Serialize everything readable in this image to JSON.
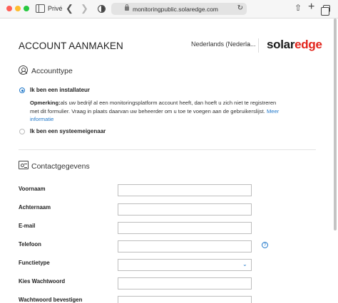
{
  "browser": {
    "private_label": "Privé",
    "url": "monitoringpublic.solaredge.com"
  },
  "header": {
    "title": "ACCOUNT AANMAKEN",
    "language": "Nederlands (Nederla...",
    "logo_main": "solar",
    "logo_accent": "edge"
  },
  "account_type": {
    "title": "Accounttype",
    "options": [
      {
        "label": "Ik ben een installateur",
        "selected": true
      },
      {
        "label": "Ik ben een systeemeigenaar",
        "selected": false
      }
    ],
    "note_bold": "Opmerking:",
    "note_text": "als uw bedrijf al een monitoringsplatform account heeft, dan hoeft u zich niet te registreren met dit formulier. Vraag in plaats daarvan uw beheerder om u toe te voegen aan de gebruikerslijst. ",
    "note_link": "Meer informatie"
  },
  "contact": {
    "title": "Contactgegevens",
    "fields": [
      {
        "label": "Voornaam",
        "value": ""
      },
      {
        "label": "Achternaam",
        "value": ""
      },
      {
        "label": "E-mail",
        "value": ""
      },
      {
        "label": "Telefoon",
        "value": ""
      },
      {
        "label": "Functietype",
        "value": ""
      },
      {
        "label": "Kies Wachtwoord",
        "value": ""
      },
      {
        "label": "Wachtwoord bevestigen",
        "value": ""
      }
    ]
  },
  "colors": {
    "accent": "#1f77c9",
    "brand_red": "#e2231a"
  },
  "icons": [
    "private-browsing-icon",
    "back-icon",
    "forward-icon",
    "shield-icon",
    "lock-icon",
    "reload-icon",
    "share-icon",
    "new-tab-icon",
    "tabs-overview-icon",
    "user-circle-icon",
    "contact-card-icon",
    "chevron-down-icon",
    "help-icon"
  ]
}
